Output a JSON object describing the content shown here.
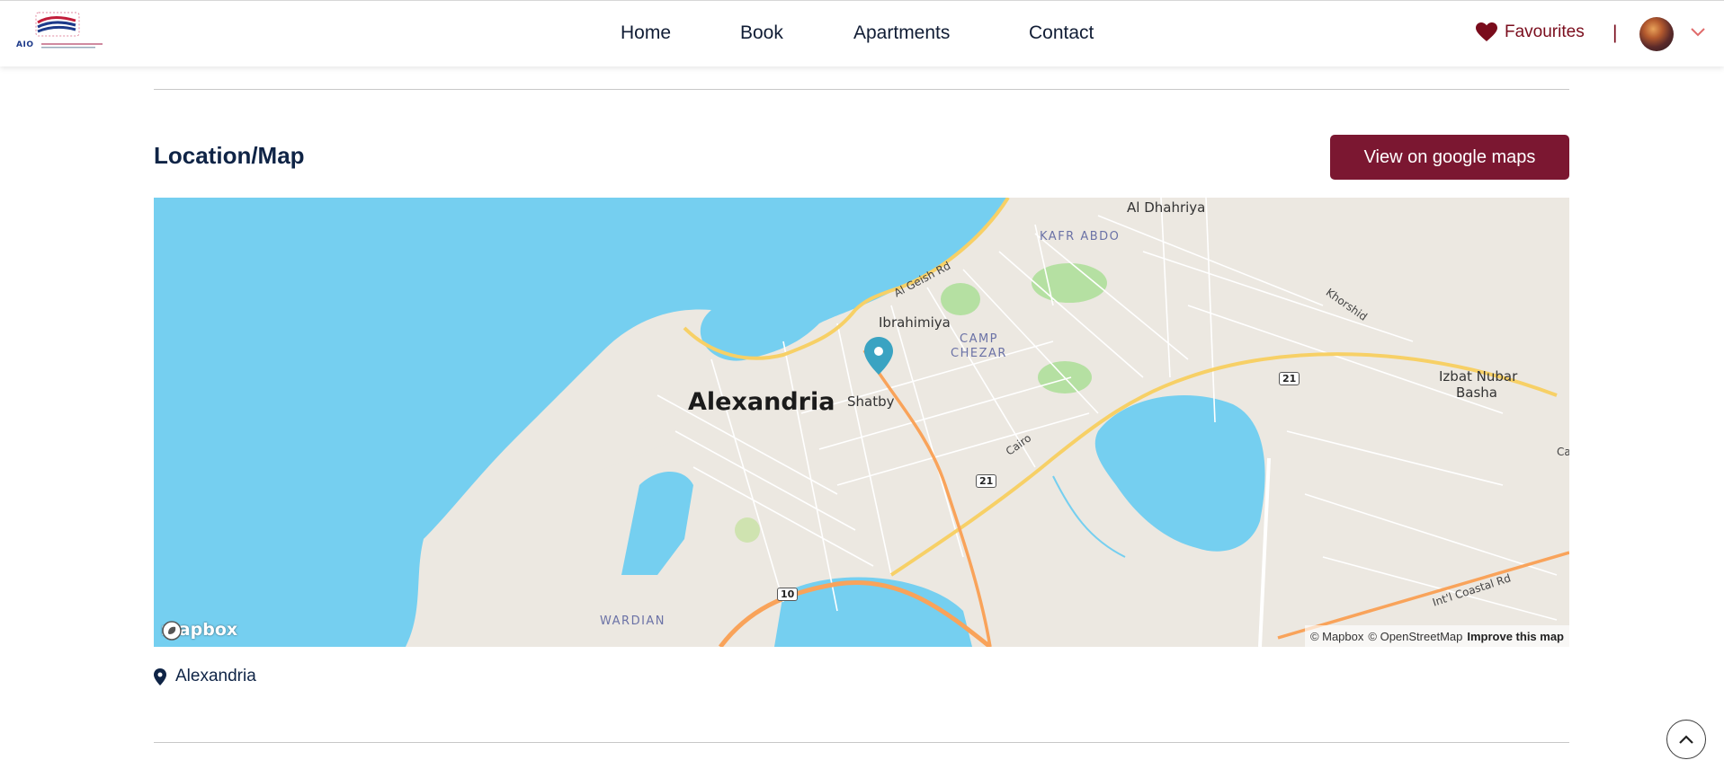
{
  "header": {
    "logo_caption": "AIO",
    "nav": [
      "Home",
      "Book",
      "Apartments",
      "Contact"
    ],
    "favourites_label": "Favourites",
    "separator": "|"
  },
  "location": {
    "title": "Location/Map",
    "gmaps_button": "View on google maps",
    "address": "Alexandria"
  },
  "map": {
    "city": "Alexandria",
    "places": [
      "Al Dhahriya",
      "Ibrahimiya",
      "Shatby",
      "Izbat Nubar",
      "Basha"
    ],
    "districts": [
      "KAFR ABDO",
      "CAMP",
      "CHEZAR",
      "WARDIAN"
    ],
    "roads": [
      "Al Geish Rd",
      "Khorshid",
      "Cairo",
      "Int'l Coastal Rd",
      "Ca"
    ],
    "shields": [
      "21",
      "21",
      "10"
    ],
    "brand": "mapbox",
    "attribution": [
      "© Mapbox",
      "© OpenStreetMap",
      "Improve this map"
    ]
  },
  "colors": {
    "accent": "#7b1731",
    "navy": "#0f2446",
    "water": "#75cff0",
    "land": "#ece8e1",
    "marker": "#3aa3c2"
  }
}
